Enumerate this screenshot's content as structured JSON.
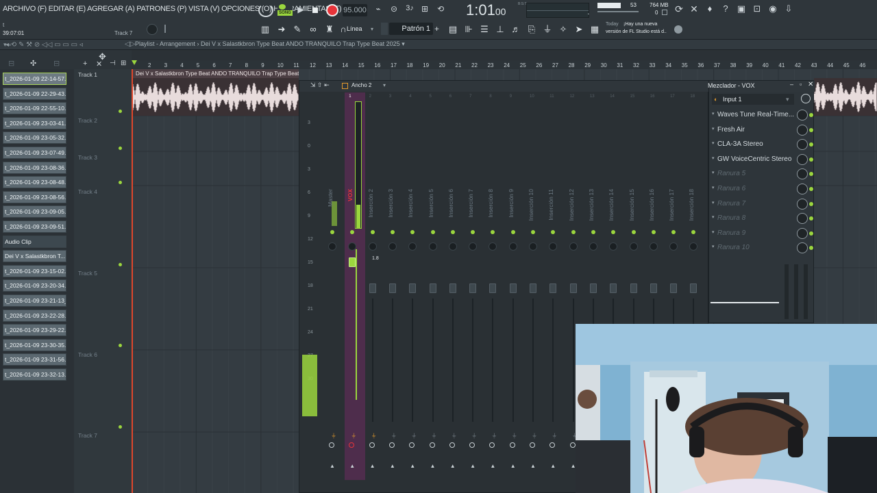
{
  "menu_text": "ARCHIVO (F) EDITAR (E) AGREGAR (A) PATRONES (P) VISTA (V) OPCIONES (O) HERRAMIENTAS (T) AYUDA",
  "hint": {
    "line1": "t",
    "line2": "39:07:01",
    "track_hint": "Track 7"
  },
  "transport": {
    "mode": "SONG",
    "tempo": "95.000",
    "time": "1:01",
    "time_frac": "00",
    "time_unit": "B:S:T"
  },
  "meters": {
    "cpu": "53",
    "memory": "764 MB",
    "poly": "0"
  },
  "toolbar": {
    "snap": "Línea",
    "pattern": "Patrón 1"
  },
  "news": {
    "date": "Today",
    "line1": "¡Hay una nueva",
    "line2": "versión de FL Studio está d.."
  },
  "playlist": {
    "title": "Playlist - Arrangement",
    "breadcrumb": "Dei V x Salastkbron Type Beat  ANDO TRANQUILO  Trap Type Beat 2025",
    "clip_title": "Dei V x Salastkbron Type Beat  ANDO TRANQUILO  Trap Type Beat 2025"
  },
  "ruler_marks": [
    "2",
    "3",
    "4",
    "5",
    "6",
    "7",
    "8",
    "9",
    "10",
    "11",
    "12",
    "13",
    "14",
    "15",
    "16",
    "17",
    "18",
    "19",
    "20",
    "21",
    "22",
    "23",
    "24",
    "25",
    "26",
    "27",
    "28",
    "29",
    "30",
    "31",
    "32",
    "33",
    "34",
    "35",
    "36",
    "37",
    "38",
    "39",
    "40",
    "41",
    "42",
    "43",
    "44",
    "45",
    "46"
  ],
  "browser_clips": [
    "t_2026-01-09 22-14-57...",
    "t_2026-01-09 22-29-43...",
    "t_2026-01-09 22-55-10...",
    "t_2026-01-09 23-03-41...",
    "t_2026-01-09 23-05-32...",
    "t_2026-01-09 23-07-49...",
    "t_2026-01-09 23-08-36...",
    "t_2026-01-09 23-08-48...",
    "t_2026-01-09 23-08-56...",
    "t_2026-01-09 23-09-05...",
    "t_2026-01-09 23-09-51...",
    "Audio Clip",
    "Dei V x Salastkbron T...",
    "t_2026-01-09 23-15-02...",
    "t_2026-01-09 23-20-34...",
    "t_2026-01-09 23-21-13_...",
    "t_2026-01-09 23-22-28...",
    "t_2026-01-09 23-29-22...",
    "t_2026-01-09 23-30-35...",
    "t_2026-01-09 23-31-56...",
    "t_2026-01-09 23-32-13..."
  ],
  "tracks": [
    "Track 1",
    "Track 2",
    "Track 3",
    "Track 4",
    "Track 5",
    "Track 6",
    "Track 7"
  ],
  "mixer": {
    "width_label": "Ancho 2",
    "scale": [
      "3",
      "0",
      "3",
      "6",
      "9",
      "12",
      "15",
      "18",
      "21",
      "24",
      "27",
      "30"
    ],
    "volume_readout": "1.8",
    "strips": [
      "Master",
      "VOX",
      "Inserción 2",
      "Inserción 3",
      "Inserción 4",
      "Inserción 5",
      "Inserción 6",
      "Inserción 7",
      "Inserción 8",
      "Inserción 9",
      "Inserción 10",
      "Inserción 11",
      "Inserción 12",
      "Inserción 13",
      "Inserción 14",
      "Inserción 15",
      "Inserción 16",
      "Inserción 17",
      "Inserción 18"
    ],
    "strip_numbers": [
      "",
      "1",
      "2",
      "3",
      "4",
      "5",
      "6",
      "7",
      "8",
      "9",
      "10",
      "11",
      "12",
      "13",
      "14",
      "15",
      "16",
      "17",
      "18"
    ]
  },
  "fx_panel": {
    "title": "Mezclador - VOX",
    "input": "Input 1",
    "slots": [
      "Waves Tune Real-Time...",
      "Fresh Air",
      "CLA-3A Stereo",
      "GW VoiceCentric Stereo",
      "Ranura 5",
      "Ranura 6",
      "Ranura 7",
      "Ranura 8",
      "Ranura 9",
      "Ranura 10"
    ],
    "active_slots": 4
  },
  "colors": {
    "accent_green": "#9bd63e",
    "record_red": "#e8343a",
    "vox_purple": "#5a3a5c",
    "waveform": "#e8dcdc"
  }
}
